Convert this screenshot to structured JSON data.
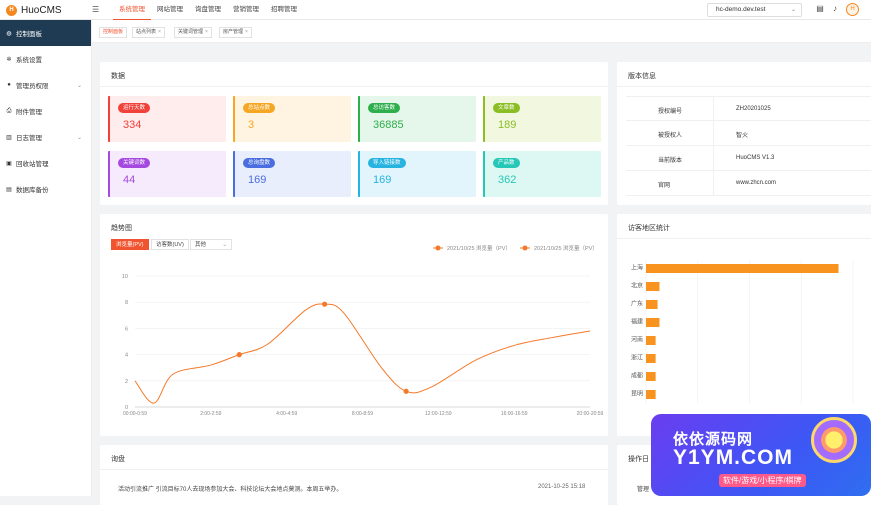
{
  "app": {
    "name": "HuoCMS",
    "logo_letter": "H",
    "menu_icon": "hamburger-icon"
  },
  "topnav": [
    {
      "label": "系统管理",
      "active": true
    },
    {
      "label": "网站管理"
    },
    {
      "label": "询盘管理"
    },
    {
      "label": "营销管理"
    },
    {
      "label": "招聘管理"
    }
  ],
  "site_select": {
    "value": "hc-demo.dev.test"
  },
  "header_icons": [
    "message-icon",
    "bell-icon"
  ],
  "sidebar": [
    {
      "label": "控制面板",
      "icon": "dashboard-icon",
      "active": true
    },
    {
      "label": "系统设置",
      "icon": "gear-icon"
    },
    {
      "label": "管理员权限",
      "icon": "user-icon",
      "expandable": true
    },
    {
      "label": "附件管理",
      "icon": "attachment-icon"
    },
    {
      "label": "日志管理",
      "icon": "log-icon",
      "expandable": true
    },
    {
      "label": "回收站管理",
      "icon": "trash-icon"
    },
    {
      "label": "数据库备份",
      "icon": "database-icon"
    }
  ],
  "page_tabs": [
    {
      "label": "控制面板",
      "active": true
    },
    {
      "label": "站点列表"
    },
    {
      "label": "关键词管理"
    },
    {
      "label": "房产管理"
    }
  ],
  "data_card": {
    "title": "数据",
    "stats": [
      {
        "label": "运行天数",
        "value": "334",
        "color": "#f0413a",
        "bg": "#ffecec"
      },
      {
        "label": "总站点数",
        "value": "3",
        "color": "#f5a623",
        "bg": "#fff4e2"
      },
      {
        "label": "总访客数",
        "value": "36885",
        "color": "#2fae4d",
        "bg": "#e5f7ea"
      },
      {
        "label": "文章数",
        "value": "189",
        "color": "#8bbd24",
        "bg": "#f1f8df"
      },
      {
        "label": "关键词数",
        "value": "44",
        "color": "#a54ae0",
        "bg": "#f5ebfc"
      },
      {
        "label": "总询盘数",
        "value": "169",
        "color": "#4a6ee0",
        "bg": "#e9eefc"
      },
      {
        "label": "导入链接数",
        "value": "169",
        "color": "#26b3e0",
        "bg": "#e2f5fc"
      },
      {
        "label": "产品数",
        "value": "362",
        "color": "#25c7b7",
        "bg": "#ddf7f3"
      }
    ]
  },
  "version_card": {
    "title": "版本信息",
    "rows": [
      {
        "k": "授权编号",
        "v": "ZH20201025"
      },
      {
        "k": "被授权人",
        "v": "智火"
      },
      {
        "k": "当前版本",
        "v": "HuoCMS V1.3"
      },
      {
        "k": "官网",
        "v": "www.zhcn.com"
      }
    ]
  },
  "trend_card": {
    "title": "趋势图",
    "btn_pv": "浏览量(PV)",
    "btn_uv": "访客数(UV)",
    "other": "其他",
    "legend": [
      "2021/10/25 浏览量（PV）",
      "2021/10/25 浏览量（PV）"
    ]
  },
  "chart_data": {
    "type": "line",
    "x": [
      "00:00-0:59",
      "",
      "2:00-2:59",
      "",
      "4:00-4:59",
      "",
      "8:00-8:59",
      "",
      "12:00-12:59",
      "",
      "16:00-16:59",
      "",
      "20:00-20:59"
    ],
    "x_ticks": [
      "00:00-0:59",
      "2:00-2:59",
      "4:00-4:59",
      "8:00-8:59",
      "12:00-12:59",
      "16:00-16:59",
      "20:00-20:59"
    ],
    "series": [
      {
        "name": "2021/10/25 浏览量（PV）",
        "points": [
          [
            0,
            2
          ],
          [
            0.5,
            0.3
          ],
          [
            1,
            2.5
          ],
          [
            2,
            3.2
          ],
          [
            2.75,
            4
          ],
          [
            3.5,
            4.8
          ],
          [
            4.5,
            7.4
          ],
          [
            5,
            7.85
          ],
          [
            5.5,
            7.2
          ],
          [
            6.5,
            3
          ],
          [
            7.15,
            1.2
          ],
          [
            7.8,
            1.5
          ],
          [
            9,
            3.6
          ],
          [
            10,
            4.7
          ],
          [
            11,
            5.3
          ],
          [
            12,
            5.8
          ]
        ]
      }
    ],
    "markers": [
      [
        2.75,
        4
      ],
      [
        5,
        7.85
      ],
      [
        7.15,
        1.2
      ]
    ],
    "ylim": [
      0,
      10
    ],
    "yticks": [
      0,
      2,
      4,
      6,
      8,
      10
    ],
    "color": "#f5792a"
  },
  "region_card": {
    "title": "访客地区统计",
    "regions": [
      {
        "name": "上海",
        "value": 100
      },
      {
        "name": "北京",
        "value": 7
      },
      {
        "name": "广东",
        "value": 6
      },
      {
        "name": "福建",
        "value": 7
      },
      {
        "name": "河南",
        "value": 5
      },
      {
        "name": "浙江",
        "value": 5
      },
      {
        "name": "成都",
        "value": 5
      },
      {
        "name": "昆明",
        "value": 5
      }
    ]
  },
  "inquiry_card": {
    "title": "询盘",
    "row_text": "活动引流推广  引流目标70人去现场参加大会、科技论坛大会地点莫测。本周五举办。",
    "row_time": "2021-10-25 15:18"
  },
  "oplog_card": {
    "title": "操作日",
    "row_label": "管理"
  },
  "watermark": {
    "l1": "依依源码网",
    "l2": "Y1YM.COM",
    "l3": "软件/游戏/小程序/棋牌"
  }
}
